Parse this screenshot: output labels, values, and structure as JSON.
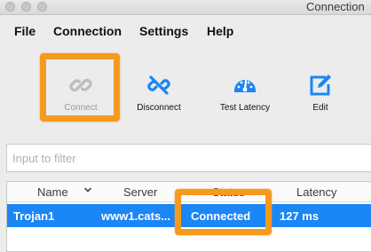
{
  "window": {
    "title": "Connection"
  },
  "menu": [
    "File",
    "Connection",
    "Settings",
    "Help"
  ],
  "toolbar": {
    "connect_label": "Connect",
    "disconnect_label": "Disconnect",
    "test_latency_label": "Test Latency",
    "edit_label": "Edit"
  },
  "filter": {
    "placeholder": "Input to filter",
    "value": ""
  },
  "table": {
    "columns": [
      "Name",
      "Server",
      "Status",
      "Latency"
    ],
    "rows": [
      {
        "name": "Trojan1",
        "server": "www1.cats...",
        "status": "Connected",
        "latency": "127 ms"
      }
    ]
  },
  "colors": {
    "accent": "#1b86f5",
    "highlight": "#f59a1f",
    "disabled": "#bcbcbc"
  },
  "icons": {
    "connect": "link-icon",
    "disconnect": "broken-link-icon",
    "test_latency": "speedometer-icon",
    "edit": "edit-icon"
  }
}
